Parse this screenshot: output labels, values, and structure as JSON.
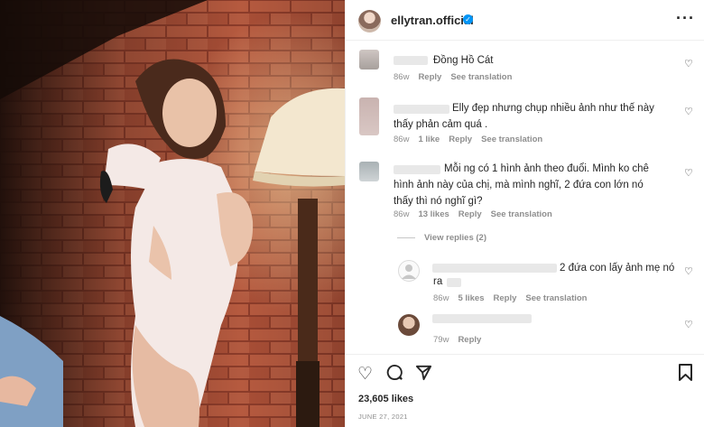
{
  "post": {
    "username": "ellytran.official",
    "likes": "23,605 likes",
    "date": "JUNE 27, 2021",
    "photo_description": "post-photo"
  },
  "comments": [
    {
      "text": "Đồng Hồ Cát",
      "time": "86w",
      "likes": "",
      "reply": "Reply",
      "translate": "See translation"
    },
    {
      "text": "Elly đẹp nhưng chụp nhiều ảnh như thế này thấy phản cảm quá .",
      "time": "86w",
      "likes": "1 like",
      "reply": "Reply",
      "translate": "See translation"
    },
    {
      "text": "Mỗi ng có 1 hình ảnh theo đuổi. Mình ko chê hình ảnh này của chị, mà mình nghĩ, 2 đứa con lớn nó thấy thì nó nghĩ gì?",
      "time": "86w",
      "likes": "13 likes",
      "reply": "Reply",
      "translate": "See translation"
    }
  ],
  "view_replies": "View replies (2)",
  "replies": [
    {
      "text_a": "2 đứa con lấy ảnh mẹ nó",
      "text_b": "ra",
      "time": "86w",
      "likes": "5 likes",
      "reply": "Reply",
      "translate": "See translation"
    },
    {
      "time": "79w",
      "reply": "Reply"
    }
  ],
  "colors": {
    "verified": "#0095f6",
    "meta": "#8e8e8e",
    "text": "#262626"
  }
}
